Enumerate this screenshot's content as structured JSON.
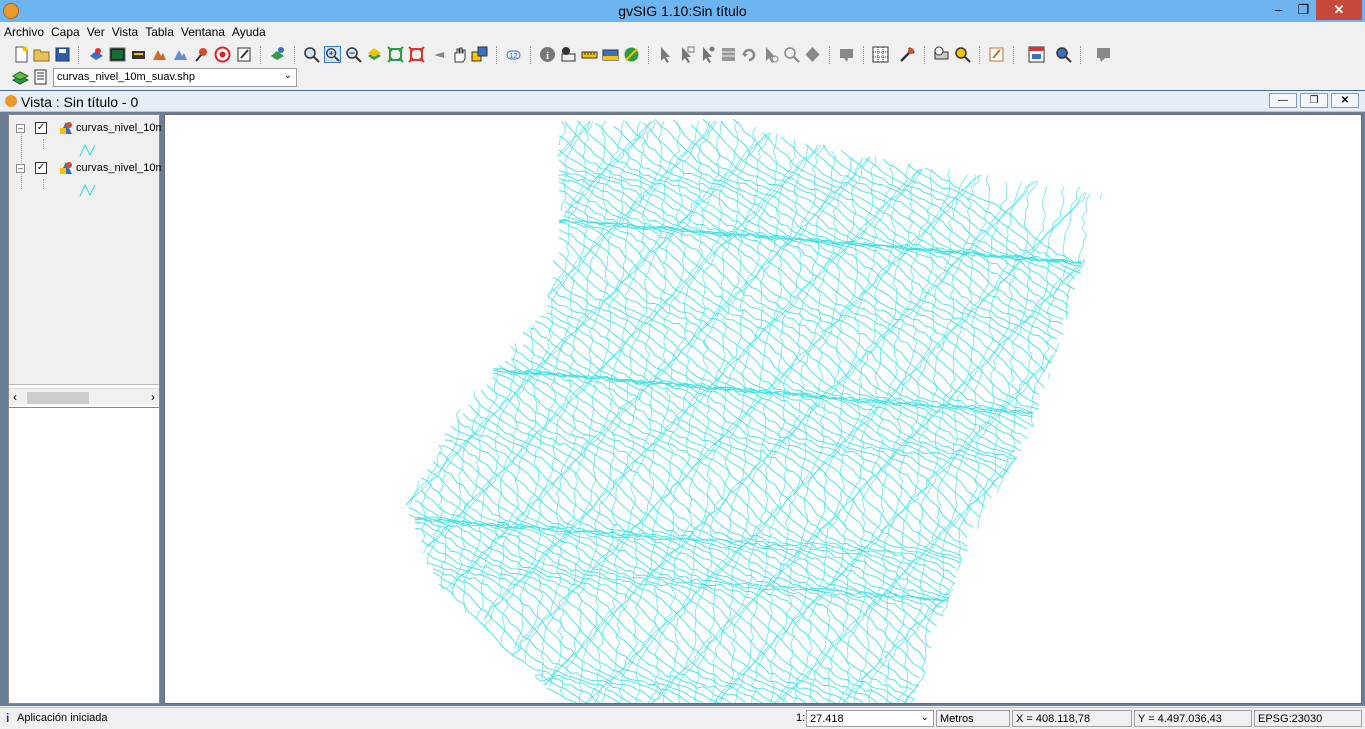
{
  "window": {
    "title": "gvSIG 1.10:Sin título",
    "minimize": "–",
    "maximize": "❐",
    "close": "✕"
  },
  "menu": [
    "Archivo",
    "Capa",
    "Ver",
    "Vista",
    "Tabla",
    "Ventana",
    "Ayuda"
  ],
  "layer_selector": {
    "value": "curvas_nivel_10m_suav.shp"
  },
  "view": {
    "title": "Vista : Sin título - 0"
  },
  "toc": {
    "layers": [
      {
        "name": "curvas_nivel_10m",
        "checked": true,
        "expanded": true
      },
      {
        "name": "curvas_nivel_10m",
        "checked": true,
        "expanded": true
      }
    ]
  },
  "map": {
    "contour_color": "#44e0e0"
  },
  "status": {
    "message": "Aplicación iniciada",
    "scale_prefix": "1:",
    "scale": "27.418",
    "units": "Metros",
    "x": "X = 408.118,78",
    "y": "Y = 4.497.036,43",
    "epsg": "EPSG:23030"
  }
}
